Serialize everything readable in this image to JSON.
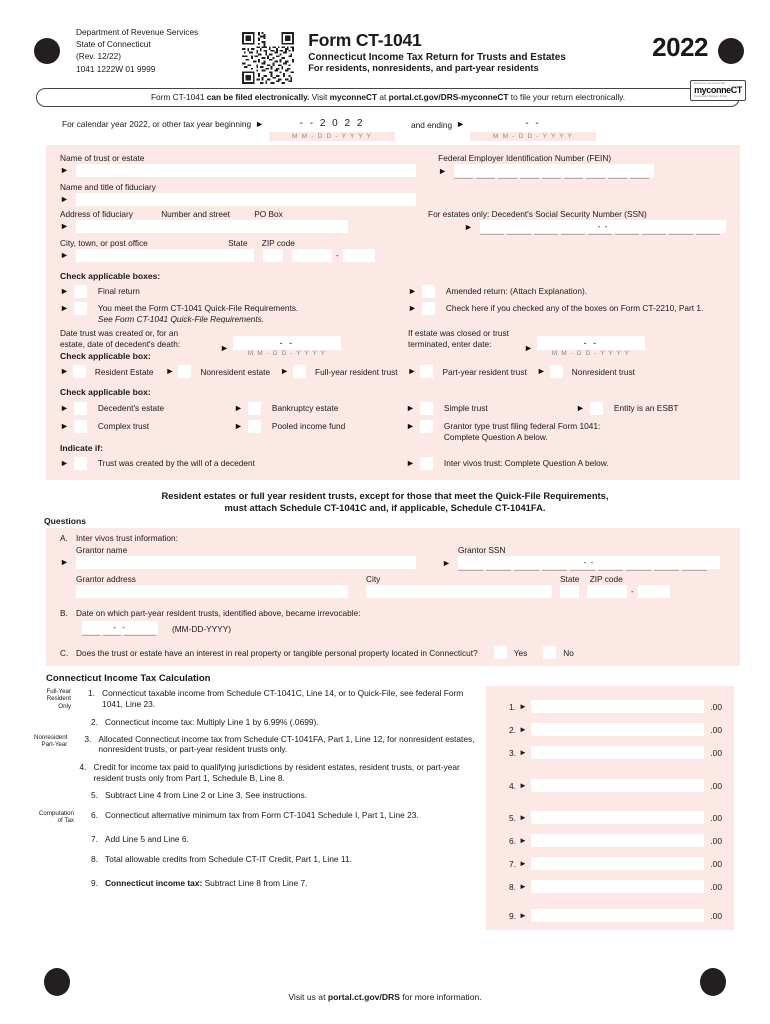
{
  "header": {
    "dept_lines": [
      "Department of Revenue Services",
      "State of Connecticut",
      "(Rev. 12/22)",
      "1041 1222W 01 9999"
    ],
    "form_title": "Form CT-1041",
    "form_sub1": "Connecticut Income Tax Return for Trusts and Estates",
    "form_sub2": "For residents, nonresidents, and part-year residents",
    "year": "2022",
    "myconnect_label": "myconneCT",
    "myconnect_micro_top": "Need your own secure self",
    "myconnect_micro_bottom": "Connecticut Taxpayer Portal"
  },
  "efile_banner": {
    "part1": "Form CT-1041 ",
    "bold1": "can be filed electronically.",
    "part2": " Visit ",
    "bold2": "myconneCT",
    "part3": " at ",
    "bold3": "portal.ct.gov/DRS-myconneCT",
    "part4": " to file your return electronically."
  },
  "calendar_year": {
    "label": "For calendar year 2022, or other tax year beginning",
    "begin_value": "-    - 2 0 2 2",
    "format_hint": "M M - D D - Y Y Y Y",
    "and_ending_label": "and ending",
    "end_value": "-      -"
  },
  "identity": {
    "name_of_trust_label": "Name of trust or estate",
    "name_of_trust_value": "",
    "fiduciary_name_label": "Name and title of fiduciary",
    "fiduciary_name_value": "",
    "address_label": "Address of fiduciary",
    "address_label2": "Number and street",
    "address_label3": "PO Box",
    "address_value": "",
    "city_label": "City, town, or post office",
    "city_value": "",
    "state_label": "State",
    "state_value": "",
    "zip_label": "ZIP code",
    "zip_value": "",
    "zip_ext_value": "",
    "fein_label": "Federal Employer Identification Number (FEIN)",
    "fein_value": "",
    "ssn_label": "For estates only: Decedent's Social Security Number (SSN)",
    "ssn_value": "-                -"
  },
  "check_boxes_1": {
    "heading": "Check applicable boxes:",
    "items": [
      {
        "label": "Final return",
        "checked": false
      },
      {
        "label": "Amended return: (Attach Explanation).",
        "checked": false
      },
      {
        "label": "You meet the Form CT-1041 Quick-File Requirements.",
        "label2": "See Form CT-1041 Quick-File Requirements.",
        "checked": false
      },
      {
        "label": "Check here if you checked any of the boxes on Form CT-2210, Part 1.",
        "checked": false
      }
    ]
  },
  "dates": {
    "created_label_l1": "Date trust was created or, for an",
    "created_label_l2": "estate, date of decedent's death:",
    "created_value": "-        -",
    "closed_label_l1": "If estate was closed or trust",
    "closed_label_l2": "terminated, enter date:",
    "closed_value": "-        -",
    "format_hint": "M M - D D - Y Y Y Y"
  },
  "residency": {
    "heading": "Check applicable box:",
    "items": [
      {
        "label": "Resident Estate",
        "checked": false
      },
      {
        "label": "Nonresident estate",
        "checked": false
      },
      {
        "label": "Full-year resident trust",
        "checked": false
      },
      {
        "label": "Part-year resident trust",
        "checked": false
      },
      {
        "label": "Nonresident trust",
        "checked": false
      }
    ]
  },
  "entity_type": {
    "heading": "Check applicable box:",
    "row1": [
      {
        "label": "Decedent's estate",
        "checked": false
      },
      {
        "label": "Bankruptcy estate",
        "checked": false
      },
      {
        "label": "Simple trust",
        "checked": false
      },
      {
        "label": "Entity is an ESBT",
        "checked": false
      }
    ],
    "row2": [
      {
        "label": "Complex trust",
        "checked": false
      },
      {
        "label": "Pooled income fund",
        "checked": false
      },
      {
        "label": "Grantor type trust filing federal Form 1041:",
        "label2": "Complete Question A below.",
        "checked": false
      }
    ],
    "indicate_heading": "Indicate if:",
    "row3": [
      {
        "label": "Trust was created by the will of a decedent",
        "checked": false
      },
      {
        "label": "Inter vivos trust: Complete Question A below.",
        "checked": false
      }
    ]
  },
  "midheading": {
    "line1": "Resident estates or full year resident trusts, except for those that meet the Quick-File Requirements,",
    "line2": "must attach Schedule CT-1041C and, if applicable, Schedule CT-1041FA."
  },
  "questions": {
    "heading": "Questions",
    "a_letter": "A.",
    "a_label": "Inter vivos trust information:",
    "grantor_name_label": "Grantor name",
    "grantor_name_value": "",
    "grantor_ssn_label": "Grantor SSN",
    "grantor_ssn_value": "-                -",
    "grantor_address_label": "Grantor address",
    "grantor_address_value": "",
    "city_label": "City",
    "city_value": "",
    "state_label": "State",
    "state_value": "",
    "zip_label": "ZIP code",
    "zip_value": "",
    "zip_ext_value": "",
    "b_letter": "B.",
    "b_label": "Date on which part-year resident trusts, identified above, became irrevocable:",
    "b_value": "-      -",
    "b_format": "(MM-DD-YYYY)",
    "c_letter": "C.",
    "c_label": "Does the trust or estate have an interest in real property or tangible personal property located in Connecticut?",
    "c_yes": "Yes",
    "c_no": "No"
  },
  "tax_calc": {
    "heading": "Connecticut Income Tax Calculation",
    "side_labels": {
      "full_year": "Full-Year\nResident\nOnly",
      "nonresident": "Nonresident\nPart-Year",
      "computation": "Computation\nof Tax"
    },
    "side_full_year_l1": "Full-Year",
    "side_full_year_l2": "Resident",
    "side_full_year_l3": "Only",
    "side_nonres_l1": "Nonresident",
    "side_nonres_l2": "Part-Year",
    "side_comp_l1": "Computation",
    "side_comp_l2": "of Tax",
    "lines": [
      {
        "num": "1.",
        "text": "Connecticut taxable income from Schedule CT-1041C, Line 14, or to Quick-File, see federal Form 1041, Line 23.",
        "amount": "",
        "cents": ".00"
      },
      {
        "num": "2.",
        "text": "Connecticut income tax: Multiply Line 1 by 6.99% (.0699).",
        "amount": "",
        "cents": ".00"
      },
      {
        "num": "3.",
        "text": "Allocated Connecticut income tax from Schedule CT-1041FA, Part 1, Line 12, for nonresident estates, nonresident trusts, or part-year resident trusts only.",
        "amount": "",
        "cents": ".00"
      },
      {
        "num": "4.",
        "text": "Credit for income tax paid to qualifying jurisdictions by resident estates, resident trusts, or part-year resident trusts only from Part 1, Schedule B, Line 8.",
        "amount": "",
        "cents": ".00"
      },
      {
        "num": "5.",
        "text": "Subtract Line 4 from Line 2 or Line 3. See instructions.",
        "amount": "",
        "cents": ".00"
      },
      {
        "num": "6.",
        "text": "Connecticut alternative minimum tax from Form CT-1041 Schedule I, Part 1, Line 23.",
        "amount": "",
        "cents": ".00"
      },
      {
        "num": "7.",
        "text": "Add Line 5 and Line 6.",
        "amount": "",
        "cents": ".00"
      },
      {
        "num": "8.",
        "text": "Total allowable credits from Schedule CT-IT Credit, Part 1, Line 11.",
        "amount": "",
        "cents": ".00"
      },
      {
        "num": "9.",
        "text_bold": "Connecticut income tax:",
        "text": " Subtract Line 8 from Line 7.",
        "amount": "",
        "cents": ".00"
      }
    ]
  },
  "footer": {
    "prefix": "Visit us at ",
    "bold": "portal.ct.gov/DRS",
    "suffix": " for more information."
  },
  "colors": {
    "form_pink": "#fce8e4",
    "field_white": "#ffffff",
    "ink": "#1a1a1a",
    "marker_black": "#231f20"
  }
}
